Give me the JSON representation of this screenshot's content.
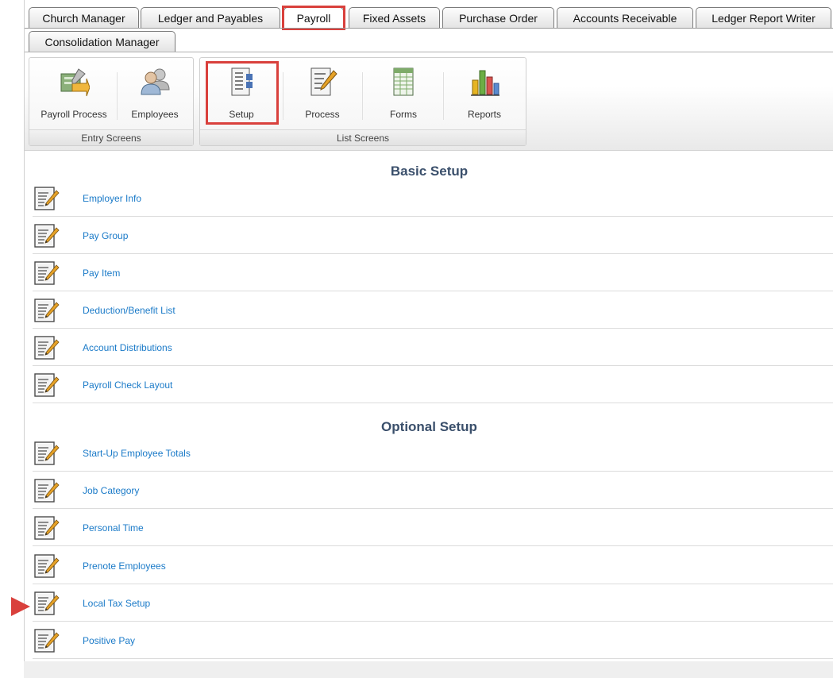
{
  "tabs": {
    "row1": [
      {
        "label": "Church Manager"
      },
      {
        "label": "Ledger and Payables"
      },
      {
        "label": "Payroll",
        "active": true
      },
      {
        "label": "Fixed Assets"
      },
      {
        "label": "Purchase Order"
      },
      {
        "label": "Accounts Receivable"
      },
      {
        "label": "Ledger Report Writer"
      }
    ],
    "row2": [
      {
        "label": "Consolidation Manager"
      }
    ]
  },
  "ribbon": {
    "entry_group": {
      "label": "Entry Screens",
      "buttons": [
        {
          "label": "Payroll Process",
          "icon": "payroll-process-icon"
        },
        {
          "label": "Employees",
          "icon": "employees-icon"
        }
      ]
    },
    "list_group": {
      "label": "List Screens",
      "buttons": [
        {
          "label": "Setup",
          "icon": "setup-icon",
          "selected": true
        },
        {
          "label": "Process",
          "icon": "process-icon"
        },
        {
          "label": "Forms",
          "icon": "forms-icon"
        },
        {
          "label": "Reports",
          "icon": "reports-icon"
        }
      ]
    }
  },
  "basic_setup": {
    "title": "Basic Setup",
    "items": [
      {
        "label": "Employer Info"
      },
      {
        "label": "Pay Group"
      },
      {
        "label": "Pay Item"
      },
      {
        "label": "Deduction/Benefit List"
      },
      {
        "label": "Account Distributions"
      },
      {
        "label": "Payroll Check Layout"
      }
    ]
  },
  "optional_setup": {
    "title": "Optional Setup",
    "items": [
      {
        "label": "Start-Up Employee Totals"
      },
      {
        "label": "Job Category"
      },
      {
        "label": "Personal Time"
      },
      {
        "label": "Prenote Employees"
      },
      {
        "label": "Local Tax Setup"
      },
      {
        "label": "Positive Pay"
      }
    ]
  },
  "colors": {
    "highlight": "#d9403c",
    "link": "#1a7ac8",
    "section_title": "#3a4f6b"
  }
}
